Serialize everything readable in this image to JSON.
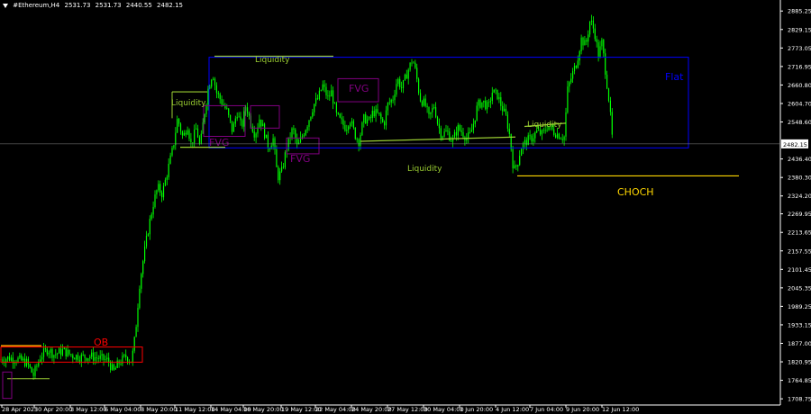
{
  "header": {
    "symbol": "#Ethereum,H4",
    "ohlc": [
      "2531.73",
      "2531.73",
      "2440.55",
      "2482.15"
    ]
  },
  "current_price": "2482.15",
  "colors": {
    "background": "#000000",
    "candle": "#00ff00",
    "axis": "#ffffff",
    "flat_box": "#0000ff",
    "liquidity": "#9acd32",
    "fvg": "#800080",
    "ob": "#ff0000",
    "choch": "#ffd700",
    "ob_line": "#ffa500"
  },
  "annotations": {
    "liquidity_label": "Liquidity",
    "fvg_label": "FVG",
    "ob_label": "OB",
    "flat_label": "Flat",
    "choch_label": "CHOCH"
  },
  "chart_data": {
    "type": "candlestick",
    "ylim": [
      1680,
      2920
    ],
    "y_ticks": [
      "2885.25",
      "2829.15",
      "2773.05",
      "2716.95",
      "2660.80",
      "2604.70",
      "2548.60",
      "2436.40",
      "2380.30",
      "2324.20",
      "2269.95",
      "2213.65",
      "2157.55",
      "2101.45",
      "2045.35",
      "1989.25",
      "1933.15",
      "1877.00",
      "1820.95",
      "1764.85",
      "1708.75"
    ],
    "x_ticks": [
      "28 Apr 2025",
      "30 Apr 20:00",
      "3 May 12:00",
      "6 May 04:00",
      "8 May 20:00",
      "11 May 12:00",
      "14 May 04:00",
      "16 May 20:00",
      "19 May 12:00",
      "22 May 04:00",
      "24 May 20:00",
      "27 May 12:00",
      "30 May 04:00",
      "1 Jun 20:00",
      "4 Jun 12:00",
      "7 Jun 04:00",
      "9 Jun 20:00",
      "12 Jun 12:00"
    ],
    "close_path": [
      [
        0,
        1828
      ],
      [
        10,
        1833
      ],
      [
        20,
        1828
      ],
      [
        30,
        1818
      ],
      [
        37,
        1780
      ],
      [
        45,
        1838
      ],
      [
        53,
        1860
      ],
      [
        60,
        1843
      ],
      [
        70,
        1855
      ],
      [
        80,
        1840
      ],
      [
        90,
        1836
      ],
      [
        100,
        1838
      ],
      [
        110,
        1832
      ],
      [
        120,
        1825
      ],
      [
        126,
        1790
      ],
      [
        131,
        1815
      ],
      [
        140,
        1838
      ],
      [
        146,
        1822
      ],
      [
        150,
        1900
      ],
      [
        155,
        2060
      ],
      [
        160,
        2150
      ],
      [
        165,
        2230
      ],
      [
        170,
        2300
      ],
      [
        175,
        2350
      ],
      [
        180,
        2330
      ],
      [
        186,
        2400
      ],
      [
        192,
        2470
      ],
      [
        197,
        2560
      ],
      [
        203,
        2500
      ],
      [
        208,
        2540
      ],
      [
        212,
        2480
      ],
      [
        218,
        2530
      ],
      [
        222,
        2470
      ],
      [
        226,
        2560
      ],
      [
        231,
        2650
      ],
      [
        236,
        2700
      ],
      [
        240,
        2640
      ],
      [
        246,
        2610
      ],
      [
        252,
        2580
      ],
      [
        258,
        2520
      ],
      [
        263,
        2580
      ],
      [
        268,
        2530
      ],
      [
        273,
        2600
      ],
      [
        278,
        2550
      ],
      [
        283,
        2510
      ],
      [
        288,
        2560
      ],
      [
        292,
        2530
      ],
      [
        298,
        2470
      ],
      [
        303,
        2500
      ],
      [
        308,
        2380
      ],
      [
        313,
        2400
      ],
      [
        318,
        2470
      ],
      [
        325,
        2530
      ],
      [
        330,
        2470
      ],
      [
        336,
        2510
      ],
      [
        342,
        2550
      ],
      [
        348,
        2600
      ],
      [
        353,
        2620
      ],
      [
        358,
        2660
      ],
      [
        364,
        2620
      ],
      [
        368,
        2640
      ],
      [
        373,
        2570
      ],
      [
        378,
        2550
      ],
      [
        384,
        2530
      ],
      [
        388,
        2560
      ],
      [
        394,
        2510
      ],
      [
        398,
        2490
      ],
      [
        404,
        2560
      ],
      [
        410,
        2550
      ],
      [
        414,
        2580
      ],
      [
        420,
        2570
      ],
      [
        426,
        2540
      ],
      [
        430,
        2600
      ],
      [
        436,
        2620
      ],
      [
        441,
        2680
      ],
      [
        446,
        2650
      ],
      [
        452,
        2700
      ],
      [
        458,
        2740
      ],
      [
        462,
        2690
      ],
      [
        466,
        2620
      ],
      [
        472,
        2600
      ],
      [
        476,
        2560
      ],
      [
        482,
        2600
      ],
      [
        486,
        2540
      ],
      [
        490,
        2510
      ],
      [
        496,
        2520
      ],
      [
        502,
        2490
      ],
      [
        508,
        2530
      ],
      [
        512,
        2520
      ],
      [
        518,
        2500
      ],
      [
        522,
        2510
      ],
      [
        526,
        2550
      ],
      [
        530,
        2600
      ],
      [
        536,
        2610
      ],
      [
        542,
        2590
      ],
      [
        546,
        2640
      ],
      [
        552,
        2630
      ],
      [
        556,
        2600
      ],
      [
        562,
        2560
      ],
      [
        566,
        2500
      ],
      [
        570,
        2400
      ],
      [
        574,
        2420
      ],
      [
        578,
        2470
      ],
      [
        584,
        2490
      ],
      [
        590,
        2500
      ],
      [
        596,
        2520
      ],
      [
        602,
        2510
      ],
      [
        608,
        2540
      ],
      [
        614,
        2520
      ],
      [
        620,
        2510
      ],
      [
        626,
        2500
      ],
      [
        630,
        2650
      ],
      [
        636,
        2700
      ],
      [
        640,
        2730
      ],
      [
        645,
        2800
      ],
      [
        650,
        2780
      ],
      [
        655,
        2860
      ],
      [
        660,
        2820
      ],
      [
        664,
        2750
      ],
      [
        668,
        2790
      ],
      [
        672,
        2700
      ],
      [
        676,
        2610
      ],
      [
        680,
        2480
      ]
    ],
    "flat_box": {
      "x0": 232,
      "x1": 764,
      "y0": 2745,
      "y1": 2470
    },
    "choch_line": {
      "x0": 574,
      "x1": 820,
      "y": 2385
    },
    "ob_box": {
      "x0": 1,
      "x1": 158,
      "y0": 1866,
      "y1": 1820
    }
  }
}
